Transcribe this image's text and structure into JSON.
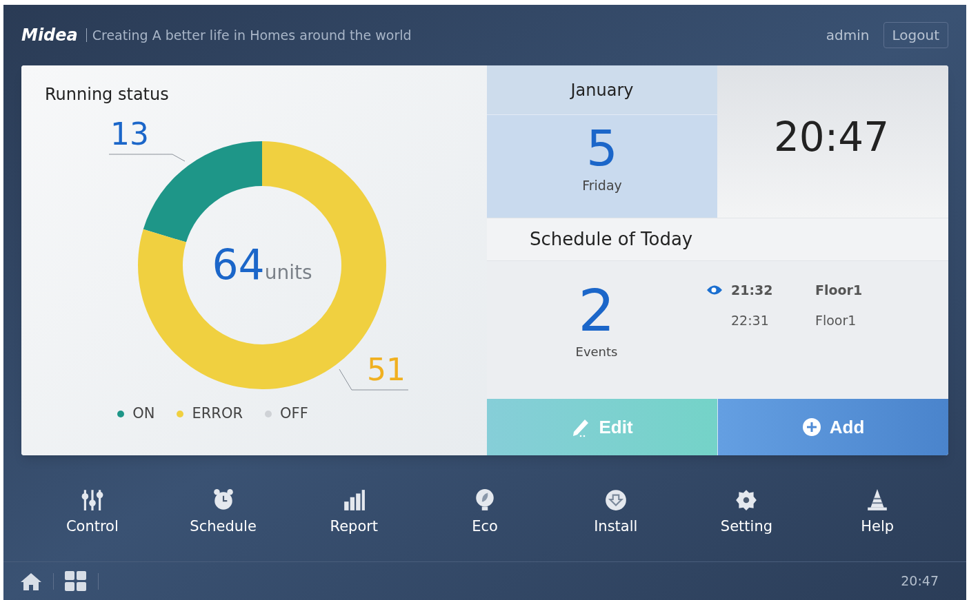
{
  "header": {
    "logo": "Midea",
    "slogan": "Creating A better life in Homes around the world",
    "user": "admin",
    "logout": "Logout"
  },
  "running_status": {
    "title": "Running status",
    "total": "64",
    "chart_data": {
      "type": "donut",
      "categories": [
        "ON",
        "ERROR",
        "OFF"
      ],
      "series": [
        {
          "name": "units",
          "values": [
            13,
            51,
            0
          ]
        }
      ],
      "data_labels": true
    },
    "legend": [
      {
        "color": "#1e9688"
      },
      {
        "color": "#f0d040"
      },
      {
        "color": "#cfd2d6"
      }
    ]
  },
  "calendar": {
    "month": "January",
    "day": "5",
    "weekday": "Friday"
  },
  "clock": "20:47",
  "schedule": {
    "title": "Schedule of Today",
    "count": "2",
    "count_label": "Events",
    "events": [
      {
        "time": "21:32",
        "place": "Floor1",
        "selected": true
      },
      {
        "time": "22:31",
        "place": "Floor1",
        "selected": false
      }
    ]
  },
  "actions": [
    {
      "kind": "edit",
      "label": "Edit"
    },
    {
      "kind": "add",
      "label": "Add"
    }
  ],
  "nav": [
    {
      "kind": "control",
      "label": "Control"
    },
    {
      "kind": "schedule",
      "label": "Schedule"
    },
    {
      "kind": "report",
      "label": "Report"
    },
    {
      "kind": "eco",
      "label": "Eco"
    },
    {
      "kind": "install",
      "label": "Install"
    },
    {
      "kind": "setting",
      "label": "Setting"
    },
    {
      "kind": "help",
      "label": "Help"
    }
  ],
  "status_bar": {
    "time": "20:47"
  }
}
